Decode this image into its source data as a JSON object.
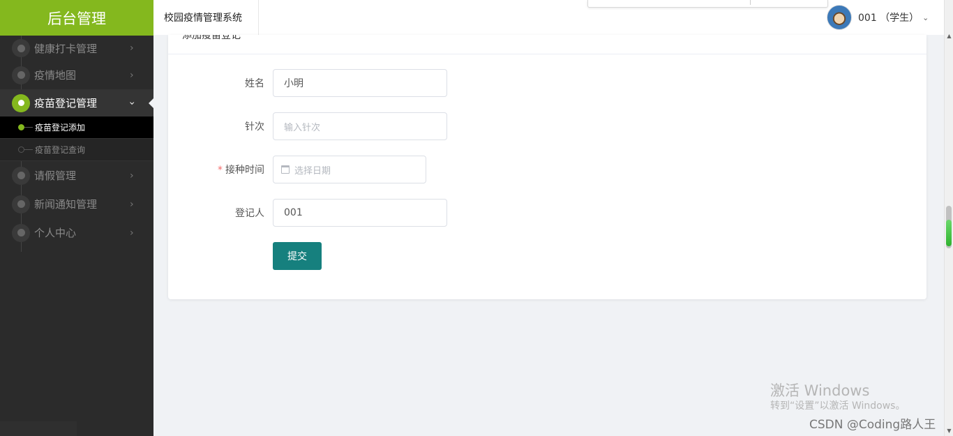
{
  "sidebar": {
    "brand": "后台管理",
    "items": [
      {
        "label": "健康打卡管理",
        "arrow": "›"
      },
      {
        "label": "疫情地图",
        "arrow": "›"
      },
      {
        "label": "疫苗登记管理",
        "arrow": "›"
      },
      {
        "label": "请假管理",
        "arrow": "›"
      },
      {
        "label": "新闻通知管理",
        "arrow": "›"
      },
      {
        "label": "个人中心",
        "arrow": "›"
      }
    ],
    "sub_items": [
      {
        "label": "疫苗登记添加"
      },
      {
        "label": "疫苗登记查询"
      }
    ]
  },
  "header": {
    "title": "校园疫情管理系统",
    "user": "001 （学生）",
    "user_chevron": "⌄"
  },
  "card": {
    "title": "添加疫苗登记",
    "fields": {
      "name": {
        "label": "姓名",
        "value": "小明"
      },
      "dose": {
        "label": "针次",
        "placeholder": "输入针次"
      },
      "date": {
        "label": "接种时间",
        "required_mark": "*",
        "placeholder": "选择日期"
      },
      "registrar": {
        "label": "登记人",
        "value": "001"
      }
    },
    "submit_label": "提交"
  },
  "watermark": {
    "title": "激活 Windows",
    "subtitle": "转到“设置”以激活 Windows。",
    "csdn": "CSDN @Coding路人王"
  },
  "colors": {
    "brand": "#84b81e",
    "sidebar_bg": "#2b2b2b",
    "submit": "#16807e"
  }
}
